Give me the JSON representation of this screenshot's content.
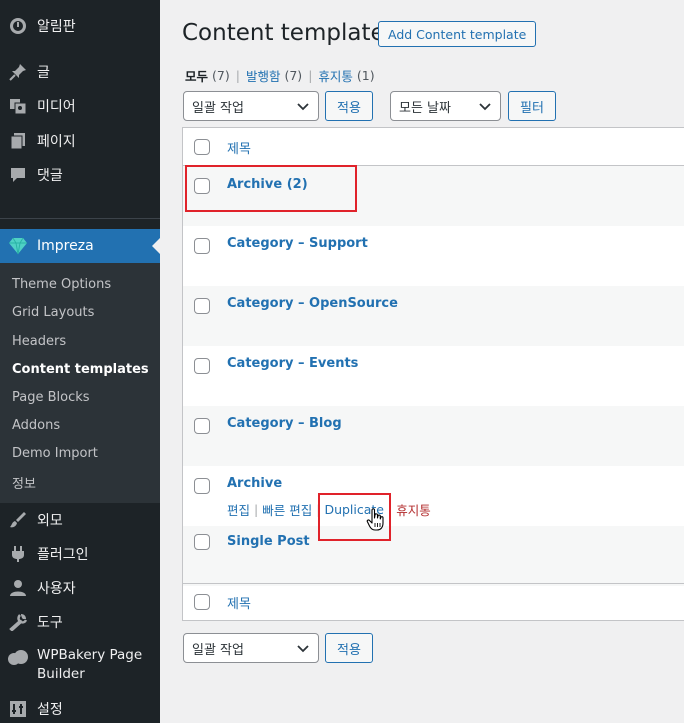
{
  "sidebar": {
    "top_items": [
      {
        "label": "알림판",
        "icon": "dashboard-icon"
      },
      {
        "label": "글",
        "icon": "pin-icon"
      },
      {
        "label": "미디어",
        "icon": "media-icon"
      },
      {
        "label": "페이지",
        "icon": "page-icon"
      },
      {
        "label": "댓글",
        "icon": "comment-icon"
      }
    ],
    "current": {
      "label": "Impreza",
      "icon": "impreza-gem-icon"
    },
    "submenu": [
      "Theme Options",
      "Grid Layouts",
      "Headers",
      "Content templates",
      "Page Blocks",
      "Addons",
      "Demo Import",
      "정보"
    ],
    "submenu_current": "Content templates",
    "bottom_items": [
      {
        "label": "외모",
        "icon": "brush-icon"
      },
      {
        "label": "플러그인",
        "icon": "plugin-icon"
      },
      {
        "label": "사용자",
        "icon": "user-icon"
      },
      {
        "label": "도구",
        "icon": "wrench-icon"
      },
      {
        "label": "WPBakery Page Builder",
        "icon": "wpbakery-icon"
      },
      {
        "label": "설정",
        "icon": "settings-icon"
      }
    ]
  },
  "header": {
    "title": "Content templates",
    "add_button": "Add Content template"
  },
  "views": {
    "all_label": "모두",
    "all_count": "(7)",
    "published_label": "발행함",
    "published_count": "(7)",
    "trash_label": "휴지통",
    "trash_count": "(1)"
  },
  "toolbar": {
    "bulk_action": "일괄 작업",
    "apply": "적용",
    "date_filter": "모든 날짜",
    "filter": "필터"
  },
  "table": {
    "column_title": "제목",
    "rows": [
      {
        "title": "Archive (2)"
      },
      {
        "title": "Category – Support"
      },
      {
        "title": "Category – OpenSource"
      },
      {
        "title": "Category – Events"
      },
      {
        "title": "Category – Blog"
      },
      {
        "title": "Archive"
      },
      {
        "title": "Single Post"
      }
    ],
    "row_actions": {
      "edit": "편집",
      "quick_edit": "빠른 편집",
      "duplicate": "Duplicate",
      "trash": "휴지통"
    }
  },
  "colors": {
    "accent": "#2271b1",
    "sidebar_bg": "#1d2327",
    "highlight": "#e0222a",
    "trash": "#b32d2e"
  }
}
